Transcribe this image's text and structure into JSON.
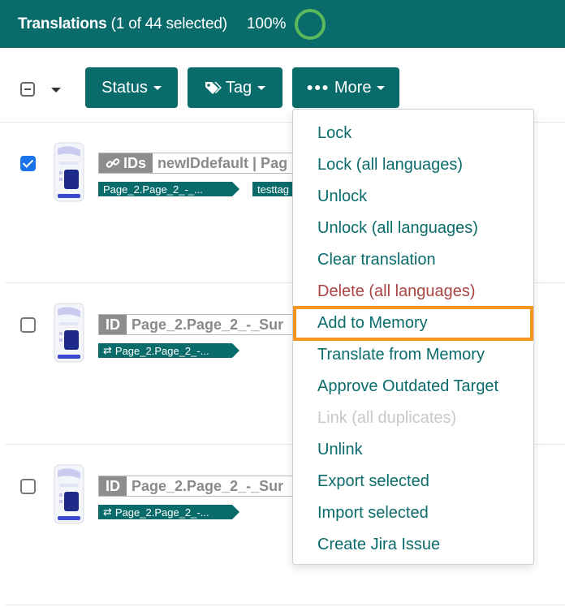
{
  "header": {
    "title_bold": "Translations",
    "title_rest": "(1 of 44 selected)",
    "percent": "100%",
    "ring_color": "#5cb85c"
  },
  "toolbar": {
    "status_label": "Status",
    "tag_label": "Tag",
    "more_label": "More"
  },
  "rows": [
    {
      "checked": true,
      "id_badge": "IDs",
      "id_text": "newIDdefault | Pag",
      "chips": [
        "Page_2.Page_2_-_...",
        "testtag"
      ]
    },
    {
      "checked": false,
      "id_badge": "ID",
      "id_text": "Page_2.Page_2_-_Sur",
      "chips": [
        "Page_2.Page_2_-..."
      ]
    },
    {
      "checked": false,
      "id_badge": "ID",
      "id_text": "Page_2.Page_2_-_Sur",
      "chips": [
        "Page_2.Page_2_-..."
      ]
    }
  ],
  "more_menu": {
    "items": [
      {
        "label": "Lock",
        "state": "normal"
      },
      {
        "label": "Lock (all languages)",
        "state": "normal"
      },
      {
        "label": "Unlock",
        "state": "normal"
      },
      {
        "label": "Unlock (all languages)",
        "state": "normal"
      },
      {
        "label": "Clear translation",
        "state": "normal"
      },
      {
        "label": "Delete (all languages)",
        "state": "danger"
      },
      {
        "label": "Add to Memory",
        "state": "highlighted"
      },
      {
        "label": "Translate from Memory",
        "state": "normal"
      },
      {
        "label": "Approve Outdated Target",
        "state": "normal"
      },
      {
        "label": "Link (all duplicates)",
        "state": "disabled"
      },
      {
        "label": "Unlink",
        "state": "normal"
      },
      {
        "label": "Export selected",
        "state": "normal"
      },
      {
        "label": "Import selected",
        "state": "normal"
      },
      {
        "label": "Create Jira Issue",
        "state": "normal"
      }
    ]
  },
  "colors": {
    "brand": "#0a6b6b",
    "danger": "#a94442",
    "highlight": "#f7941d",
    "checkbox_checked": "#1a73e8"
  }
}
